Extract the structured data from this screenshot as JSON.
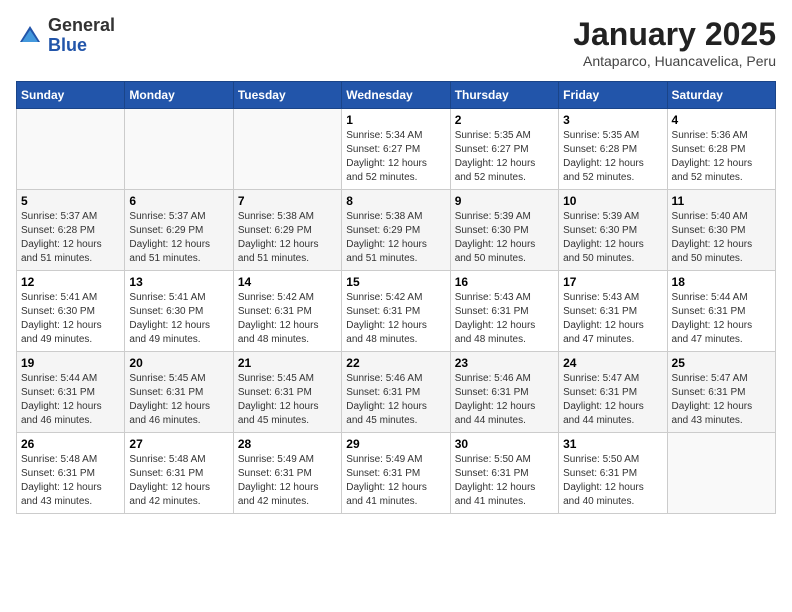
{
  "header": {
    "logo_general": "General",
    "logo_blue": "Blue",
    "month": "January 2025",
    "location": "Antaparco, Huancavelica, Peru"
  },
  "days_of_week": [
    "Sunday",
    "Monday",
    "Tuesday",
    "Wednesday",
    "Thursday",
    "Friday",
    "Saturday"
  ],
  "weeks": [
    [
      {
        "day": "",
        "info": ""
      },
      {
        "day": "",
        "info": ""
      },
      {
        "day": "",
        "info": ""
      },
      {
        "day": "1",
        "info": "Sunrise: 5:34 AM\nSunset: 6:27 PM\nDaylight: 12 hours\nand 52 minutes."
      },
      {
        "day": "2",
        "info": "Sunrise: 5:35 AM\nSunset: 6:27 PM\nDaylight: 12 hours\nand 52 minutes."
      },
      {
        "day": "3",
        "info": "Sunrise: 5:35 AM\nSunset: 6:28 PM\nDaylight: 12 hours\nand 52 minutes."
      },
      {
        "day": "4",
        "info": "Sunrise: 5:36 AM\nSunset: 6:28 PM\nDaylight: 12 hours\nand 52 minutes."
      }
    ],
    [
      {
        "day": "5",
        "info": "Sunrise: 5:37 AM\nSunset: 6:28 PM\nDaylight: 12 hours\nand 51 minutes."
      },
      {
        "day": "6",
        "info": "Sunrise: 5:37 AM\nSunset: 6:29 PM\nDaylight: 12 hours\nand 51 minutes."
      },
      {
        "day": "7",
        "info": "Sunrise: 5:38 AM\nSunset: 6:29 PM\nDaylight: 12 hours\nand 51 minutes."
      },
      {
        "day": "8",
        "info": "Sunrise: 5:38 AM\nSunset: 6:29 PM\nDaylight: 12 hours\nand 51 minutes."
      },
      {
        "day": "9",
        "info": "Sunrise: 5:39 AM\nSunset: 6:30 PM\nDaylight: 12 hours\nand 50 minutes."
      },
      {
        "day": "10",
        "info": "Sunrise: 5:39 AM\nSunset: 6:30 PM\nDaylight: 12 hours\nand 50 minutes."
      },
      {
        "day": "11",
        "info": "Sunrise: 5:40 AM\nSunset: 6:30 PM\nDaylight: 12 hours\nand 50 minutes."
      }
    ],
    [
      {
        "day": "12",
        "info": "Sunrise: 5:41 AM\nSunset: 6:30 PM\nDaylight: 12 hours\nand 49 minutes."
      },
      {
        "day": "13",
        "info": "Sunrise: 5:41 AM\nSunset: 6:30 PM\nDaylight: 12 hours\nand 49 minutes."
      },
      {
        "day": "14",
        "info": "Sunrise: 5:42 AM\nSunset: 6:31 PM\nDaylight: 12 hours\nand 48 minutes."
      },
      {
        "day": "15",
        "info": "Sunrise: 5:42 AM\nSunset: 6:31 PM\nDaylight: 12 hours\nand 48 minutes."
      },
      {
        "day": "16",
        "info": "Sunrise: 5:43 AM\nSunset: 6:31 PM\nDaylight: 12 hours\nand 48 minutes."
      },
      {
        "day": "17",
        "info": "Sunrise: 5:43 AM\nSunset: 6:31 PM\nDaylight: 12 hours\nand 47 minutes."
      },
      {
        "day": "18",
        "info": "Sunrise: 5:44 AM\nSunset: 6:31 PM\nDaylight: 12 hours\nand 47 minutes."
      }
    ],
    [
      {
        "day": "19",
        "info": "Sunrise: 5:44 AM\nSunset: 6:31 PM\nDaylight: 12 hours\nand 46 minutes."
      },
      {
        "day": "20",
        "info": "Sunrise: 5:45 AM\nSunset: 6:31 PM\nDaylight: 12 hours\nand 46 minutes."
      },
      {
        "day": "21",
        "info": "Sunrise: 5:45 AM\nSunset: 6:31 PM\nDaylight: 12 hours\nand 45 minutes."
      },
      {
        "day": "22",
        "info": "Sunrise: 5:46 AM\nSunset: 6:31 PM\nDaylight: 12 hours\nand 45 minutes."
      },
      {
        "day": "23",
        "info": "Sunrise: 5:46 AM\nSunset: 6:31 PM\nDaylight: 12 hours\nand 44 minutes."
      },
      {
        "day": "24",
        "info": "Sunrise: 5:47 AM\nSunset: 6:31 PM\nDaylight: 12 hours\nand 44 minutes."
      },
      {
        "day": "25",
        "info": "Sunrise: 5:47 AM\nSunset: 6:31 PM\nDaylight: 12 hours\nand 43 minutes."
      }
    ],
    [
      {
        "day": "26",
        "info": "Sunrise: 5:48 AM\nSunset: 6:31 PM\nDaylight: 12 hours\nand 43 minutes."
      },
      {
        "day": "27",
        "info": "Sunrise: 5:48 AM\nSunset: 6:31 PM\nDaylight: 12 hours\nand 42 minutes."
      },
      {
        "day": "28",
        "info": "Sunrise: 5:49 AM\nSunset: 6:31 PM\nDaylight: 12 hours\nand 42 minutes."
      },
      {
        "day": "29",
        "info": "Sunrise: 5:49 AM\nSunset: 6:31 PM\nDaylight: 12 hours\nand 41 minutes."
      },
      {
        "day": "30",
        "info": "Sunrise: 5:50 AM\nSunset: 6:31 PM\nDaylight: 12 hours\nand 41 minutes."
      },
      {
        "day": "31",
        "info": "Sunrise: 5:50 AM\nSunset: 6:31 PM\nDaylight: 12 hours\nand 40 minutes."
      },
      {
        "day": "",
        "info": ""
      }
    ]
  ]
}
